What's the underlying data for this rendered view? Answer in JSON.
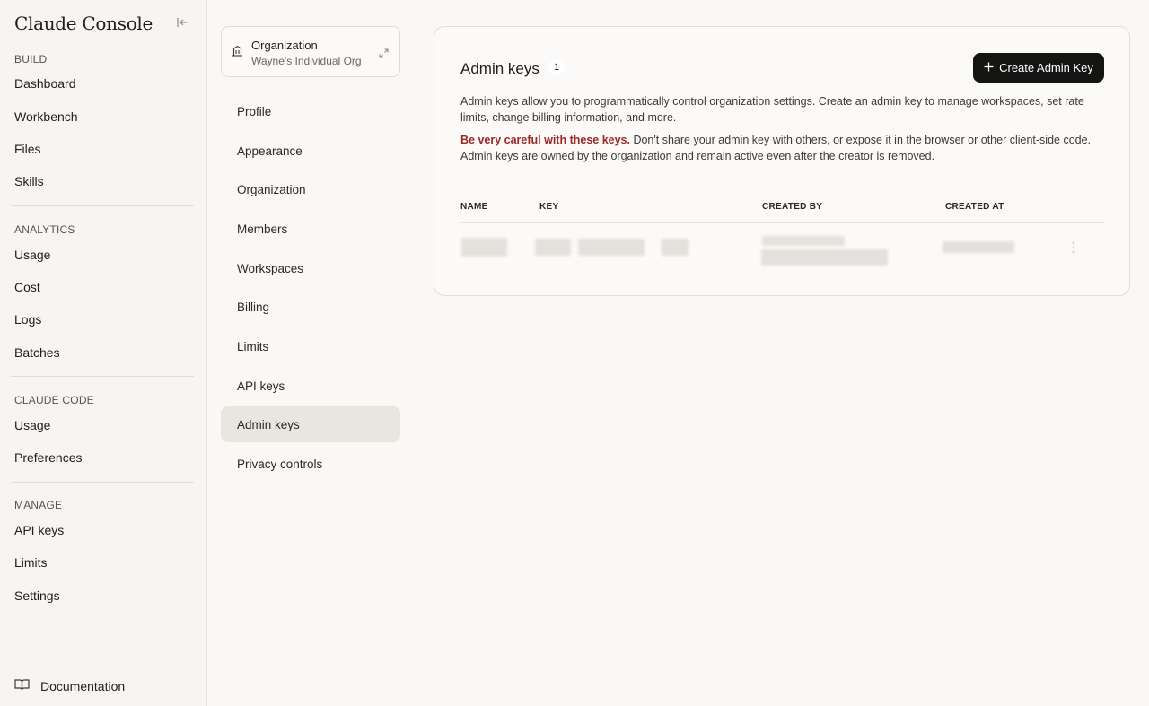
{
  "brand": "Claude Console",
  "sidebar": {
    "sections": [
      {
        "label": "BUILD",
        "items": [
          "Dashboard",
          "Workbench",
          "Files",
          "Skills"
        ]
      },
      {
        "label": "ANALYTICS",
        "items": [
          "Usage",
          "Cost",
          "Logs",
          "Batches"
        ]
      },
      {
        "label": "CLAUDE CODE",
        "items": [
          "Usage",
          "Preferences"
        ]
      },
      {
        "label": "MANAGE",
        "items": [
          "API keys",
          "Limits",
          "Settings"
        ]
      }
    ],
    "documentation": "Documentation"
  },
  "org": {
    "title": "Organization",
    "name": "Wayne's Individual Org"
  },
  "settings_nav": {
    "items": [
      "Profile",
      "Appearance",
      "Organization",
      "Members",
      "Workspaces",
      "Billing",
      "Limits",
      "API keys",
      "Admin keys",
      "Privacy controls"
    ],
    "active": "Admin keys"
  },
  "main": {
    "title": "Admin keys",
    "count": "1",
    "create_button": "Create Admin Key",
    "description": "Admin keys allow you to programmatically control organization settings. Create an admin key to manage workspaces, set rate limits, change billing information, and more.",
    "warning_strong": "Be very careful with these keys.",
    "warning_rest": " Don't share your admin key with others, or expose it in the browser or other client-side code. Admin keys are owned by the organization and remain active even after the creator is removed.",
    "table": {
      "columns": [
        "NAME",
        "KEY",
        "CREATED BY",
        "CREATED AT"
      ]
    }
  },
  "colors": {
    "accent": "#141413",
    "warning": "#9b2a26",
    "active_item": "#e8e6df"
  }
}
